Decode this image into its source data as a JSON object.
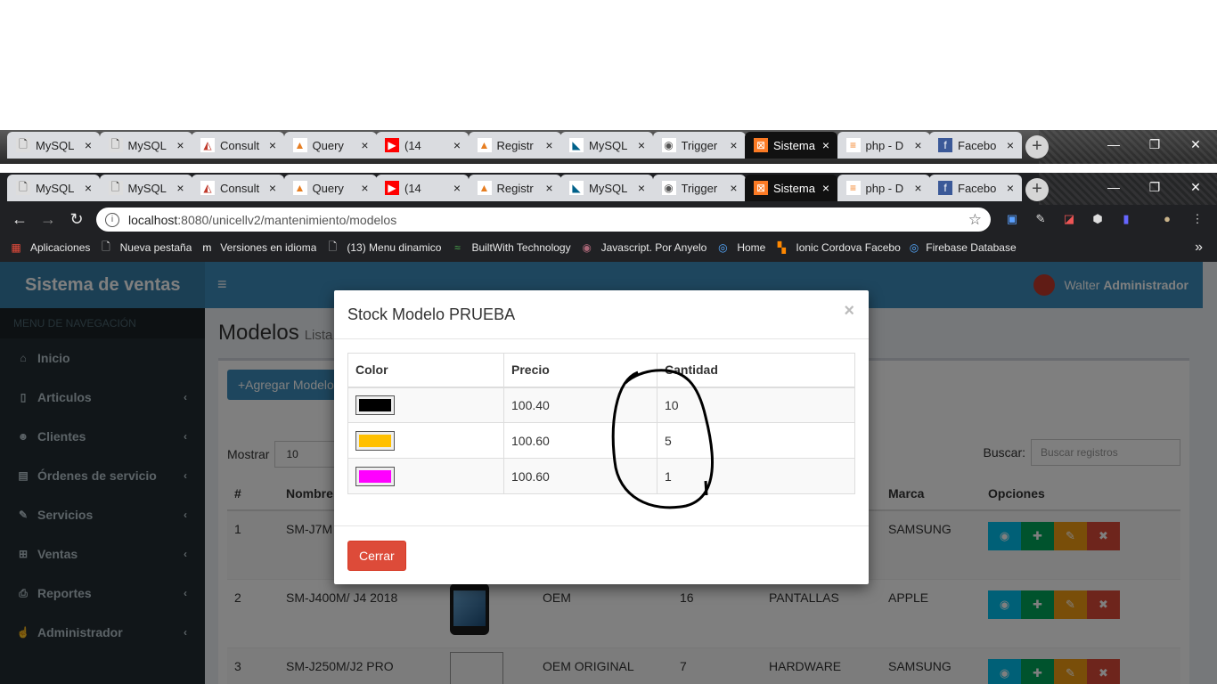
{
  "tabs": [
    {
      "title": "MySQL",
      "icon": "doc"
    },
    {
      "title": "MySQL",
      "icon": "doc"
    },
    {
      "title": "Consult",
      "icon": "A"
    },
    {
      "title": "Query",
      "icon": "flame"
    },
    {
      "title": "(14",
      "icon": "yt"
    },
    {
      "title": "Registr",
      "icon": "flame"
    },
    {
      "title": "MySQL",
      "icon": "mysql"
    },
    {
      "title": "Trigger",
      "icon": "eye"
    },
    {
      "title": "Sistema",
      "icon": "xampp"
    },
    {
      "title": "php - D",
      "icon": "so"
    },
    {
      "title": "Facebo",
      "icon": "fb"
    }
  ],
  "address": {
    "host": "localhost",
    "path": ":8080/unicellv2/mantenimiento/modelos"
  },
  "bookmarks": [
    "Aplicaciones",
    "Nueva pestaña",
    "Versiones en idioma",
    "(13) Menu dinamico",
    "BuiltWith Technology",
    "Javascript. Por Anyelo",
    "Home",
    "Ionic Cordova Facebo",
    "Firebase Database +"
  ],
  "app": {
    "brand": "Sistema de ventas",
    "user_first": "Walter",
    "user_role": "Administrador",
    "nav_header": "MENU DE NAVEGACIÓN",
    "nav": [
      {
        "label": "Inicio",
        "icon": "home-icon",
        "chev": false
      },
      {
        "label": "Articulos",
        "icon": "mobile-icon",
        "chev": true
      },
      {
        "label": "Clientes",
        "icon": "users-icon",
        "chev": true
      },
      {
        "label": "Órdenes de servicio",
        "icon": "file-icon",
        "chev": true
      },
      {
        "label": "Servicios",
        "icon": "wrench-icon",
        "chev": true
      },
      {
        "label": "Ventas",
        "icon": "cart-icon",
        "chev": true
      },
      {
        "label": "Reportes",
        "icon": "print-icon",
        "chev": true
      },
      {
        "label": "Administrador",
        "icon": "hand-icon",
        "chev": true
      }
    ],
    "page_title": "Modelos",
    "page_subtitle": "Lista",
    "add_button": "+Agregar Modelo",
    "show_label": "Mostrar",
    "show_value": "10",
    "search_label": "Buscar:",
    "search_placeholder": "Buscar registros",
    "columns": [
      "#",
      "Nombre",
      "",
      "",
      "",
      "",
      "Marca",
      "Opciones"
    ],
    "rows": [
      {
        "n": "1",
        "nombre": "SM-J7M",
        "img": "",
        "tipo": "",
        "stock": "",
        "cat": "",
        "marca": "SAMSUNG"
      },
      {
        "n": "2",
        "nombre": "SM-J400M/ J4 2018",
        "img": "phone",
        "tipo": "OEM",
        "stock": "16",
        "cat": "PANTALLAS",
        "marca": "APPLE"
      },
      {
        "n": "3",
        "nombre": "SM-J250M/J2 PRO",
        "img": "broken",
        "tipo": "OEM ORIGINAL",
        "stock": "7",
        "cat": "HARDWARE",
        "marca": "SAMSUNG"
      }
    ]
  },
  "modal": {
    "title": "Stock Modelo PRUEBA",
    "close": "×",
    "headers": {
      "color": "Color",
      "precio": "Precio",
      "cantidad": "Cantidad"
    },
    "rows": [
      {
        "color": "#000000",
        "precio": "100.40",
        "cantidad": "10"
      },
      {
        "color": "#ffc000",
        "precio": "100.60",
        "cantidad": "5"
      },
      {
        "color": "#ff00ff",
        "precio": "100.60",
        "cantidad": "1"
      }
    ],
    "cerrar": "Cerrar"
  }
}
